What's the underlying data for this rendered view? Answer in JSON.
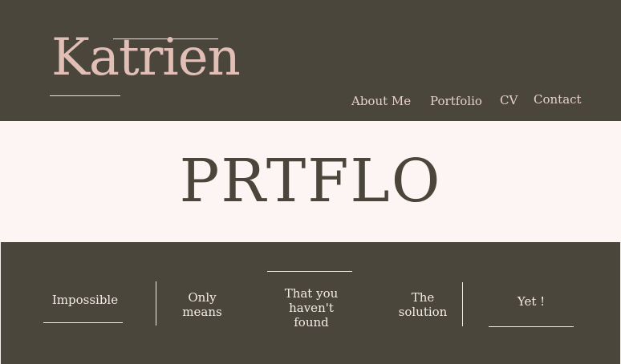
{
  "brand": {
    "name": "Katrien"
  },
  "nav": {
    "items": [
      {
        "label": "About Me"
      },
      {
        "label": "Portfolio"
      },
      {
        "label": "CV"
      },
      {
        "label": "Contact"
      }
    ]
  },
  "hero": {
    "title": "PRTFLO"
  },
  "tagline": {
    "words": [
      {
        "text": "Impossible"
      },
      {
        "text": "Only\nmeans"
      },
      {
        "text": "That you\nhaven't\nfound"
      },
      {
        "text": "The\nsolution"
      },
      {
        "text": "Yet !"
      }
    ]
  },
  "colors": {
    "background": "#4a463b",
    "hero_background": "#fdf5f3",
    "logo": "#e2bfb6",
    "text_light": "#f2ece6"
  }
}
